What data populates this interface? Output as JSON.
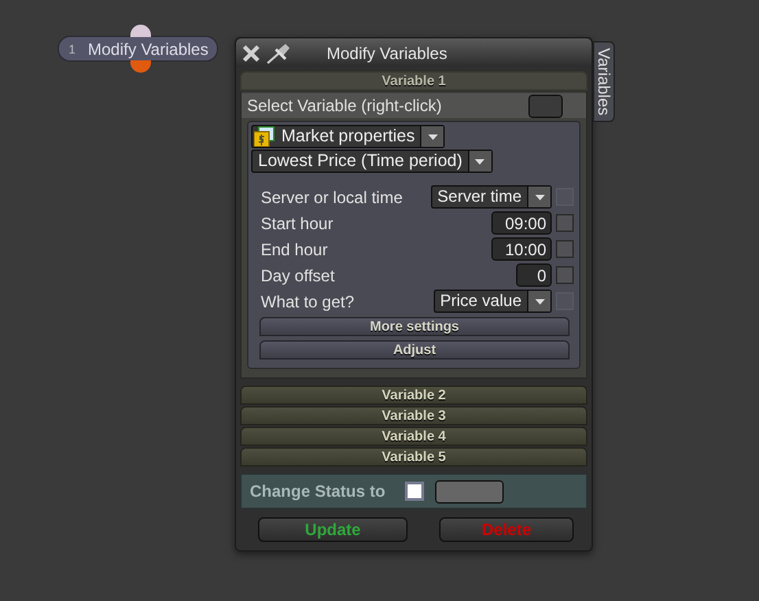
{
  "node": {
    "number": "1",
    "label": "Modify Variables"
  },
  "dialog": {
    "title": "Modify Variables",
    "side_tab": "Variables",
    "sections": [
      {
        "title": "Variable 1",
        "expanded": true
      },
      {
        "title": "Variable 2",
        "expanded": false
      },
      {
        "title": "Variable 3",
        "expanded": false
      },
      {
        "title": "Variable 4",
        "expanded": false
      },
      {
        "title": "Variable 5",
        "expanded": false
      }
    ],
    "select_variable": {
      "label": "Select Variable (right-click)"
    },
    "category": {
      "value": "Market properties"
    },
    "function": {
      "value": "Lowest Price (Time period)"
    },
    "fields": [
      {
        "kind": "dropdown",
        "label": "Server or local time",
        "value": "Server time",
        "checked": false,
        "disabled": true
      },
      {
        "kind": "input",
        "label": "Start hour",
        "value": "09:00",
        "checked": false,
        "disabled": false
      },
      {
        "kind": "input",
        "label": "End hour",
        "value": "10:00",
        "checked": false,
        "disabled": false
      },
      {
        "kind": "input",
        "label": "Day offset",
        "value": "0",
        "checked": false,
        "disabled": false
      },
      {
        "kind": "dropdown",
        "label": "What to get?",
        "value": "Price value",
        "checked": false,
        "disabled": true
      }
    ],
    "buttons": [
      "More settings",
      "Adjust"
    ],
    "status": {
      "label": "Change Status to",
      "checked": false
    },
    "actions": [
      {
        "kind": "update",
        "label": "Update"
      },
      {
        "kind": "delete",
        "label": "Delete"
      }
    ]
  }
}
